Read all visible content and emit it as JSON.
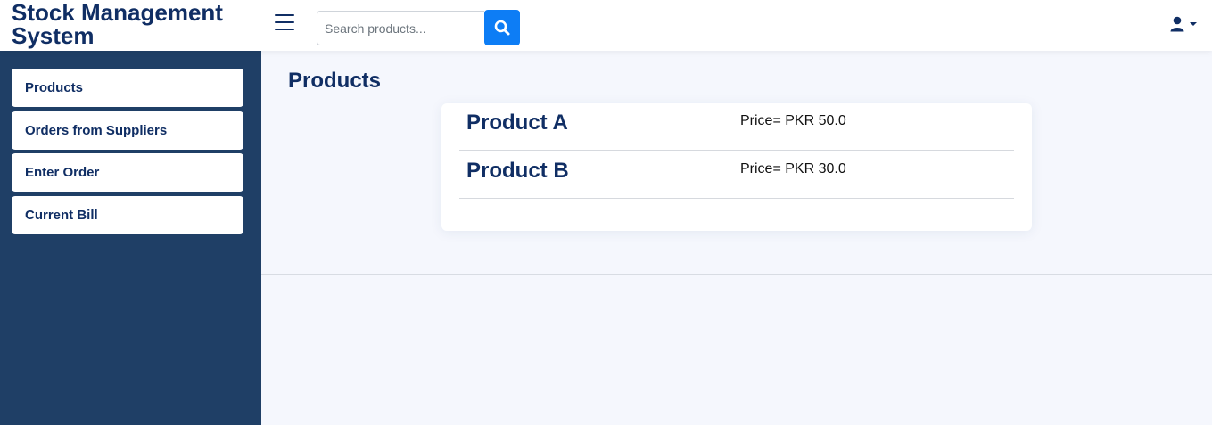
{
  "header": {
    "brand": "Stock Management System",
    "search": {
      "placeholder": "Search products...",
      "value": ""
    }
  },
  "icons": {
    "menu": "hamburger-menu-icon",
    "search": "search-icon",
    "user": "user-icon",
    "dropdown": "caret-down-icon"
  },
  "colors": {
    "brand": "#102e64",
    "sidebar": "#1f3f66",
    "accent": "#0d7df5",
    "background": "#f5f7fd"
  },
  "sidebar": {
    "items": [
      {
        "label": "Products"
      },
      {
        "label": "Orders from Suppliers"
      },
      {
        "label": "Enter Order"
      },
      {
        "label": "Current Bill"
      }
    ]
  },
  "main": {
    "title": "Products",
    "products": [
      {
        "name": "Product A",
        "price": "Price= PKR 50.0"
      },
      {
        "name": "Product B",
        "price": "Price= PKR 30.0"
      }
    ]
  }
}
